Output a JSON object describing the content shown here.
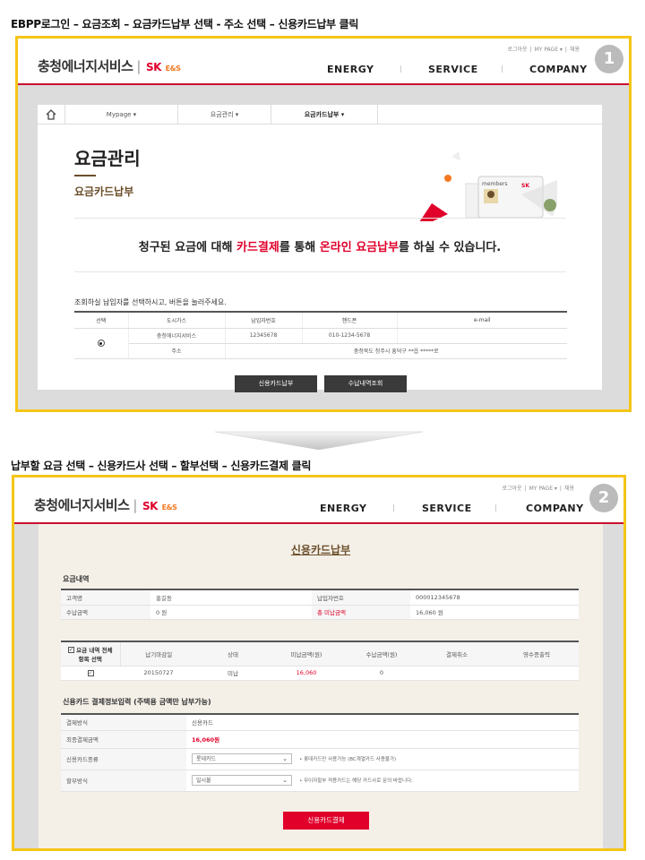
{
  "captions": {
    "step1": "EBPP로그인 – 요금조회 – 요금카드납부 선택 - 주소 선택 – 신용카드납부 클릭",
    "step2": "납부할 요금 선택 – 신용카드사 선택 – 할부선택 – 신용카드결제 클릭"
  },
  "brand": {
    "name": "충청에너지서비스",
    "sk": "SK",
    "es": "E&S",
    "accent": "#e0002a",
    "highlight": "#f5c518"
  },
  "util": {
    "logout": "로그아웃",
    "mypage": "MY PAGE ▾",
    "join": "채용"
  },
  "gnb": [
    "ENERGY",
    "SERVICE",
    "COMPANY"
  ],
  "badges": [
    "1",
    "2"
  ],
  "screen1": {
    "tabs": [
      "Mypage ▾",
      "요금관리 ▾",
      "요금카드납부 ▾"
    ],
    "title": "요금관리",
    "subtitle": "요금카드납부",
    "card_label": "members",
    "message": {
      "p1": "청구된 요금에 대해 ",
      "h1": "카드결제",
      "p2": "를 통해 ",
      "h2": "온라인 요금납부",
      "p3": "를 하실 수 있습니다."
    },
    "note": "조회하실 납입자를 선택하시고, 버튼을 눌러주세요.",
    "table": {
      "headers": [
        "선택",
        "도시가스",
        "납입자번호",
        "핸드폰",
        "e-mail"
      ],
      "row": {
        "company": "충청에너지서비스",
        "payer_no": "12345678",
        "phone": "010-1234-5678",
        "email": ""
      },
      "address_label": "주소",
      "address": "충청북도 청주시 흥덕구 **읍 *****로"
    },
    "buttons": {
      "card": "신용카드납부",
      "history": "수납내역조회"
    }
  },
  "screen2": {
    "title": "신용카드납부",
    "bill_section": "요금내역",
    "bill": {
      "customer_label": "고객명",
      "customer": "홍길동",
      "payer_label": "납입자번호",
      "payer_no": "000012345678",
      "paid_label": "수납금액",
      "paid": "0 원",
      "unpaid_label": "총 미납금액",
      "unpaid": "16,060 원"
    },
    "list": {
      "headers": [
        "요금 내역 전체항목 선택",
        "납기마감일",
        "상태",
        "미납금액(원)",
        "수납금액(원)",
        "결제취소",
        "영수증출력"
      ],
      "row": {
        "due": "20150727",
        "status": "미납",
        "unpaid": "16,060",
        "paid": "0",
        "cancel": "",
        "receipt": ""
      }
    },
    "card_section": "신용카드 결제정보입력 (주택용 금액만 납부가능)",
    "card": {
      "method_label": "결제방식",
      "method": "신용카드",
      "amount_label": "최종결제금액",
      "amount": "16,060원",
      "type_label": "신용카드종류",
      "type_value": "롯데카드",
      "type_hint": "• 롯데카드만 사용가능 (BC계열카드 사용불가)",
      "inst_label": "할부방식",
      "inst_value": "일시불",
      "inst_hint": "• 무이자할부 적용카드는 해당 카드사로 문의 바랍니다."
    },
    "pay_button": "신용카드결제"
  }
}
